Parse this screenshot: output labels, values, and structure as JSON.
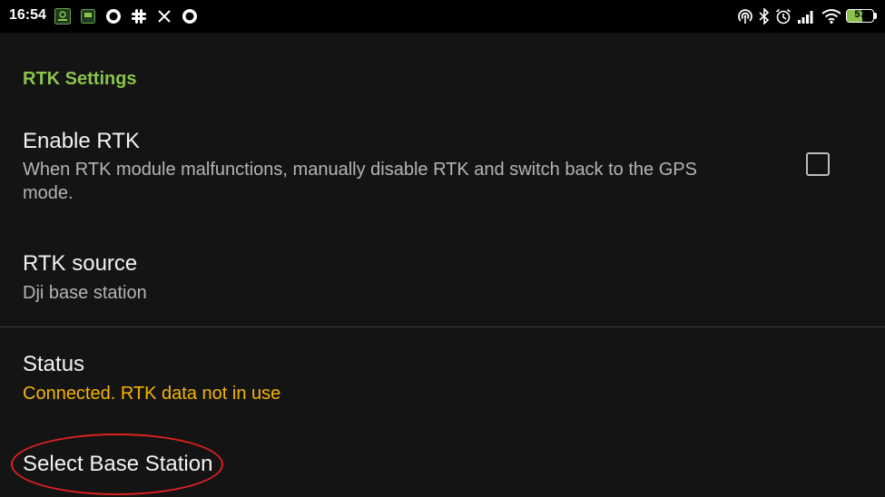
{
  "status_bar": {
    "time": "16:54",
    "battery_level": "57",
    "battery_fraction": 0.57,
    "left_icons": [
      "app-icon-1",
      "app-icon-2",
      "circle-icon",
      "slack-icon",
      "x-icon",
      "circle-icon"
    ],
    "right_icons": [
      "hotspot-icon",
      "bluetooth-icon",
      "alarm-icon",
      "signal-icon",
      "wifi-icon",
      "battery-icon"
    ]
  },
  "settings": {
    "section_header": "RTK Settings",
    "enable_rtk": {
      "title": "Enable RTK",
      "summary": "When RTK module malfunctions, manually disable RTK and switch back to the GPS mode.",
      "summary_line1": "When RTK module malfunctions, manually disable RTK and switch back to the GPS",
      "summary_line2": "mode.",
      "checked": false
    },
    "rtk_source": {
      "title": "RTK source",
      "value": "Dji base station"
    },
    "status": {
      "title": "Status",
      "value": "Connected. RTK data not in use"
    },
    "select_base_station": {
      "title": "Select Base Station"
    }
  },
  "colors": {
    "header_accent": "#8bc34a",
    "status_value": "#f5b400",
    "highlight": "#e02020",
    "background": "#141414"
  }
}
